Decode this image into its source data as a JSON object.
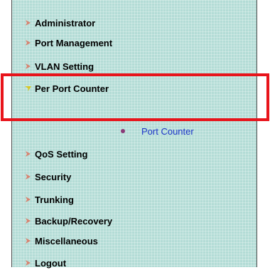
{
  "menu": {
    "items": [
      {
        "label": "Administrator",
        "expanded": false
      },
      {
        "label": "Port Management",
        "expanded": false
      },
      {
        "label": "VLAN Setting",
        "expanded": false
      },
      {
        "label": "Per Port Counter",
        "expanded": true
      },
      {
        "label": "QoS Setting",
        "expanded": false
      },
      {
        "label": "Security",
        "expanded": false
      },
      {
        "label": "Trunking",
        "expanded": false
      },
      {
        "label": "Backup/Recovery",
        "expanded": false
      },
      {
        "label": "Miscellaneous",
        "expanded": false
      },
      {
        "label": "Logout",
        "expanded": false
      }
    ],
    "subitems": [
      {
        "parent": "Per Port Counter",
        "label": "Port Counter"
      }
    ]
  },
  "colors": {
    "panel_background": "#b3dcd6",
    "arrow_collapsed": "#d8826f",
    "arrow_expanded": "#d6c726",
    "sub_link": "#1d34c8",
    "sub_bullet": "#8b3a78",
    "highlight": "#e8141b"
  },
  "icons": {
    "collapsed": "arrow-right-icon",
    "expanded": "arrow-down-icon",
    "sub_bullet": "bullet-icon"
  }
}
